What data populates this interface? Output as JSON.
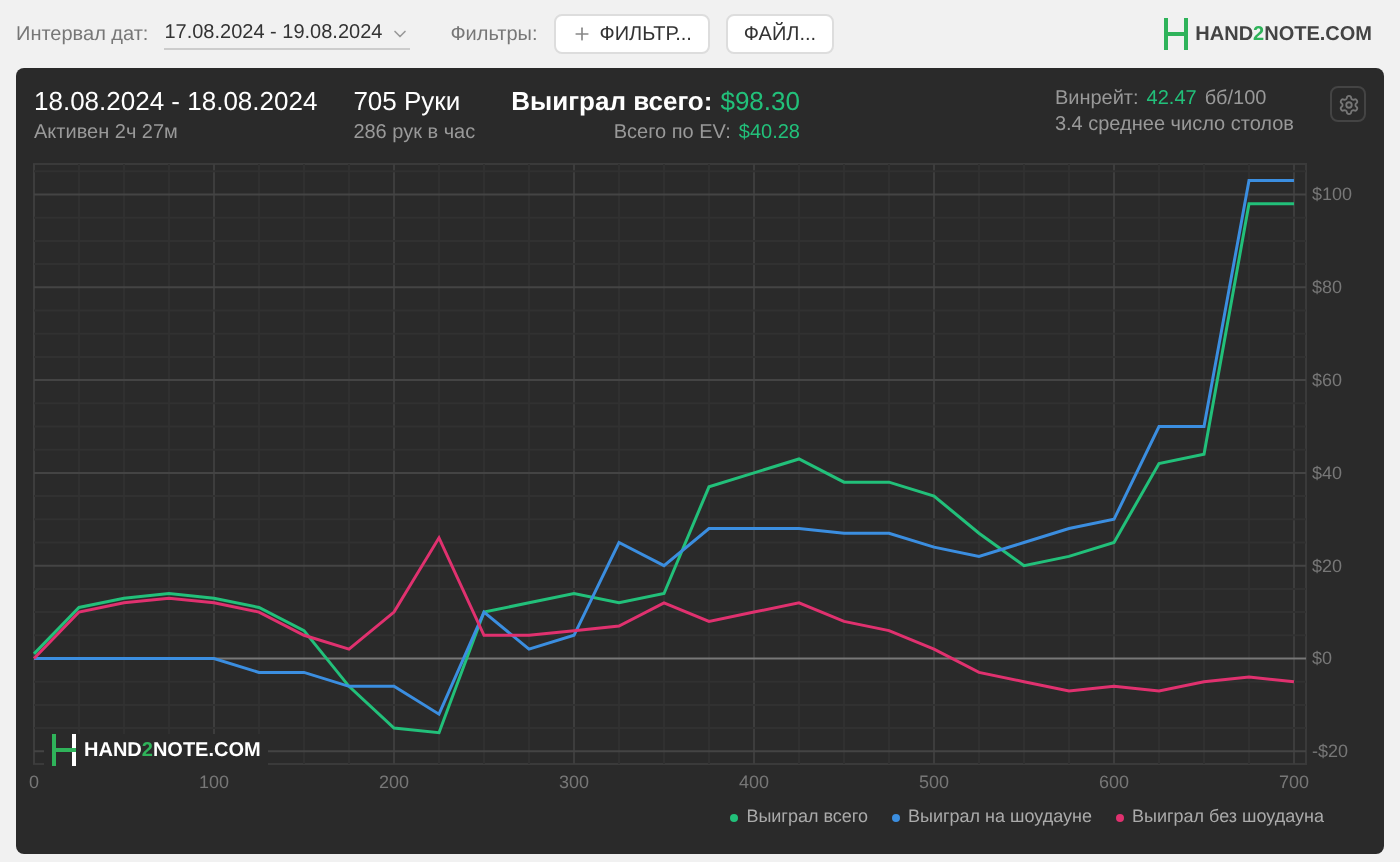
{
  "toolbar": {
    "date_label": "Интервал дат:",
    "date_value": "17.08.2024 - 19.08.2024",
    "filters_label": "Фильтры:",
    "filter_buttons": [
      {
        "label": "ФИЛЬТР...",
        "kind": "add"
      },
      {
        "label": "ФАЙЛ...",
        "kind": "plain"
      }
    ],
    "brand": [
      "HAND",
      "2",
      "NOTE.COM"
    ]
  },
  "summary": {
    "period": "18.08.2024 - 18.08.2024",
    "active": "Активен 2ч 27м",
    "hands": "705 Руки",
    "hands_rate": "286 рук в час",
    "won_label": "Выиграл всего:",
    "won_value": "$98.30",
    "ev_label": "Всего по EV:",
    "ev_value": "$40.28",
    "winrate_label": "Винрейт:",
    "winrate_value": "42.47",
    "winrate_unit": "бб/100",
    "tables": "3.4 среднее число столов"
  },
  "chart": {
    "watermark": [
      "HAND",
      "2",
      "NOTE.COM"
    ],
    "chart_data": {
      "type": "line",
      "grid": true,
      "legend": true,
      "x": [
        0,
        25,
        50,
        75,
        100,
        125,
        150,
        175,
        200,
        225,
        250,
        275,
        300,
        325,
        350,
        375,
        400,
        425,
        450,
        475,
        500,
        525,
        550,
        575,
        600,
        625,
        650,
        675,
        700
      ],
      "xlim": [
        0,
        705
      ],
      "ylim": [
        -23,
        107
      ],
      "xticks": [
        0,
        100,
        200,
        300,
        400,
        500,
        600,
        700
      ],
      "yticks": [
        {
          "value": -20,
          "label": "-$20"
        },
        {
          "value": 0,
          "label": "$0"
        },
        {
          "value": 20,
          "label": "$20"
        },
        {
          "value": 40,
          "label": "$40"
        },
        {
          "value": 60,
          "label": "$60"
        },
        {
          "value": 80,
          "label": "$80"
        },
        {
          "value": 100,
          "label": "$100"
        }
      ],
      "series": [
        {
          "name": "Выиграл всего",
          "color": "#22c07a",
          "values": [
            1,
            11,
            13,
            14,
            13,
            11,
            6,
            -6,
            -15,
            -16,
            10,
            12,
            14,
            12,
            14,
            37,
            40,
            43,
            38,
            38,
            35,
            27,
            20,
            22,
            25,
            42,
            44,
            98,
            98
          ]
        },
        {
          "name": "Выиграл на шоудауне",
          "color": "#3b8ee0",
          "values": [
            0,
            0,
            0,
            0,
            0,
            -3,
            -3,
            -6,
            -6,
            -12,
            10,
            2,
            5,
            25,
            20,
            28,
            28,
            28,
            27,
            27,
            24,
            22,
            25,
            28,
            30,
            50,
            50,
            103,
            103
          ]
        },
        {
          "name": "Выиграл без шоудауна",
          "color": "#e0316f",
          "values": [
            0,
            10,
            12,
            13,
            12,
            10,
            5,
            2,
            10,
            26,
            5,
            5,
            6,
            7,
            12,
            8,
            10,
            12,
            8,
            6,
            2,
            -3,
            -5,
            -7,
            -6,
            -7,
            -5,
            -4,
            -5
          ]
        }
      ]
    }
  }
}
